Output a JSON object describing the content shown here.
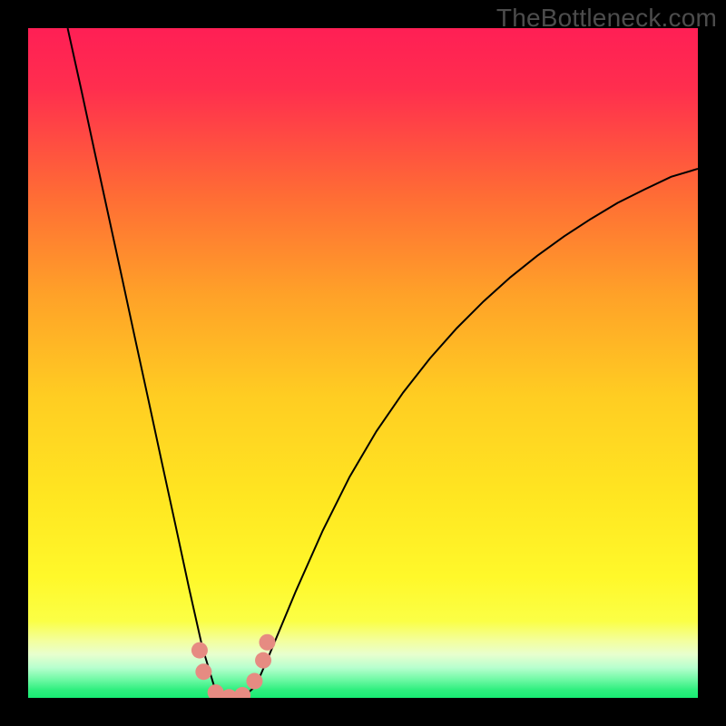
{
  "watermark": "TheBottleneck.com",
  "chart_data": {
    "type": "line",
    "title": "",
    "xlabel": "",
    "ylabel": "",
    "xlim": [
      0,
      1
    ],
    "ylim": [
      0,
      1
    ],
    "background_gradient": {
      "top": "#ff1f55",
      "mid_upper": "#ff8f2c",
      "mid": "#ffe621",
      "lower": "#fbff45",
      "band": "#f3ff9e",
      "bottom": "#18ec73"
    },
    "series": [
      {
        "name": "curve",
        "color": "#000000",
        "x": [
          0.059,
          0.08,
          0.1,
          0.12,
          0.14,
          0.16,
          0.18,
          0.2,
          0.22,
          0.24,
          0.26,
          0.28,
          0.3,
          0.32,
          0.34,
          0.36,
          0.4,
          0.44,
          0.48,
          0.52,
          0.56,
          0.6,
          0.64,
          0.68,
          0.72,
          0.76,
          0.8,
          0.84,
          0.88,
          0.92,
          0.96,
          1.0
        ],
        "y": [
          1.0,
          0.905,
          0.812,
          0.72,
          0.628,
          0.535,
          0.443,
          0.35,
          0.258,
          0.165,
          0.076,
          0.01,
          0.0,
          0.0,
          0.018,
          0.064,
          0.16,
          0.25,
          0.33,
          0.398,
          0.456,
          0.507,
          0.552,
          0.592,
          0.628,
          0.66,
          0.689,
          0.715,
          0.739,
          0.759,
          0.778,
          0.79
        ]
      },
      {
        "name": "markers",
        "type": "scatter",
        "color": "#e68b82",
        "x": [
          0.256,
          0.262,
          0.28,
          0.3,
          0.32,
          0.338,
          0.351,
          0.357
        ],
        "y": [
          0.071,
          0.039,
          0.008,
          0.001,
          0.004,
          0.025,
          0.056,
          0.083
        ]
      }
    ]
  }
}
